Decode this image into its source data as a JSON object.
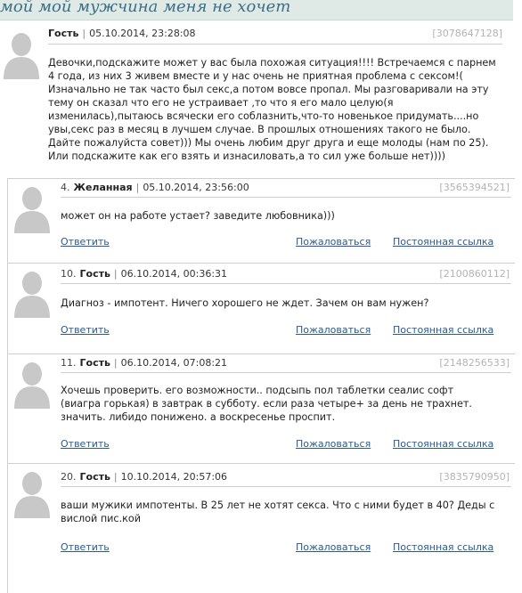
{
  "page": {
    "title": "мой мой мужчина меня не хочет"
  },
  "main_post": {
    "author": "Гость",
    "date": "05.10.2014, 23:28:08",
    "id": "[3078647128]",
    "text": "Девочки,подскажите может у вас была похожая ситуация!!!! Встречаемся с парнем 4 года, из них 3 живем вместе и у нас очень не приятная проблема с сексом!( Изначально не так часто был секс,а потом вовсе пропал. Мы разговаривали на эту тему он сказал что его не устраивает ,то что я его мало целую(я изменилась),пытаюсь всячески его соблазнить,что-то новенькое придумать....но увы,секс раз в месяц в лучшем случае. В прошлых отношениях такого не было. Дайте пожалуйста совет))) Мы очень любим друг друга и еще молоды (нам по 25). Или подскажите как его взять и изнасиловать,а то сил уже больше нет))))"
  },
  "actions": {
    "reply": "Ответить",
    "report": "Пожаловаться",
    "permalink": "Постоянная ссылка"
  },
  "replies": [
    {
      "num": "4.",
      "author": "Желанная",
      "date": "05.10.2014, 23:56:00",
      "id": "[3565394521]",
      "text": "может он на работе устает? заведите любовника)))"
    },
    {
      "num": "10.",
      "author": "Гость",
      "date": "06.10.2014, 00:36:31",
      "id": "[2100860112]",
      "text": "Диагноз - импотент. Ничего хорошего не ждет. Зачем он вам нужен?"
    },
    {
      "num": "11.",
      "author": "Гость",
      "date": "06.10.2014, 07:08:21",
      "id": "[2148256533]",
      "text": "Хочешь проверить. его возможности.. подсыпь пол таблетки сеалис софт (виагра горькая) в завтрак в субботу. если раза четыре+ за день не трахнет. значить. либидо понижено. а воскресенье проспит."
    },
    {
      "num": "20.",
      "author": "Гость",
      "date": "10.10.2014, 20:57:06",
      "id": "[3835790950]",
      "text": "ваши мужики импотенты. В 25 лет не хотят секса. Что с ними будет в 40? Деды с вислой пис.кой"
    }
  ],
  "colors": {
    "link": "#2a5a94",
    "title": "#3d6f86",
    "title_bg": "#dfeae6",
    "muted": "#b4b4b4"
  },
  "icons": {
    "avatar": "avatar-silhouette-icon"
  }
}
